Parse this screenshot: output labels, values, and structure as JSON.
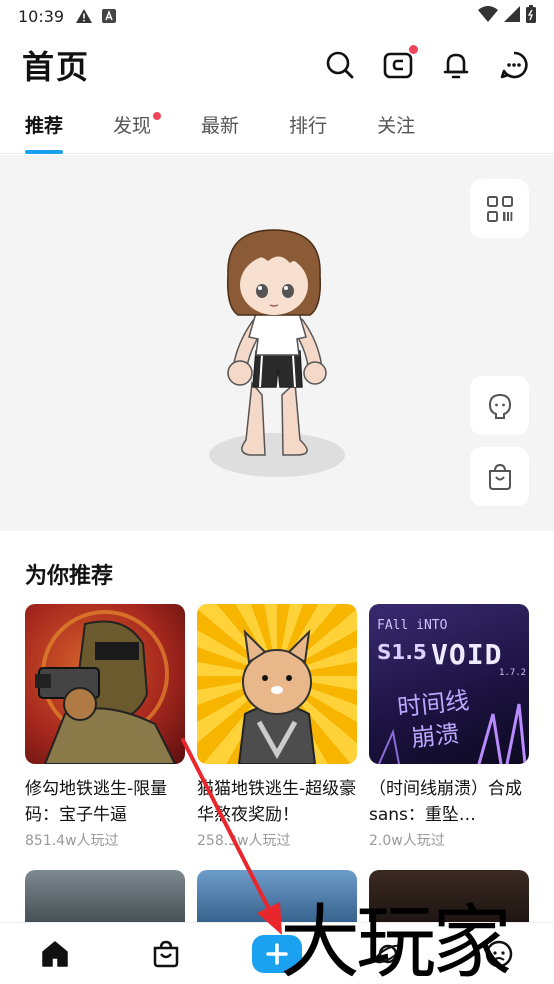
{
  "status": {
    "time": "10:39"
  },
  "header": {
    "title": "首页"
  },
  "tabs": [
    {
      "label": "推荐",
      "active": true
    },
    {
      "label": "发现",
      "dot": true
    },
    {
      "label": "最新"
    },
    {
      "label": "排行"
    },
    {
      "label": "关注"
    }
  ],
  "recommend": {
    "title": "为你推荐",
    "games": [
      {
        "name": "修勾地铁逃生-限量码：宝子牛逼",
        "plays": "851.4w人玩过"
      },
      {
        "name": "猫猫地铁逃生-超级豪华熬夜奖励！",
        "plays": "258.3w人玩过"
      },
      {
        "name": "（时间线崩溃）合成sans：重坠…",
        "plays": "2.0w人玩过"
      }
    ],
    "cover3_text": {
      "line1": "FAll iNTO",
      "line2": "VOID",
      "version": "S1.5",
      "version2": "1.7.2",
      "cn1": "时间线",
      "cn2": "崩溃"
    }
  },
  "colors": {
    "accent": "#1aa2f0",
    "badge": "#f0445a"
  },
  "watermark": "大玩家"
}
